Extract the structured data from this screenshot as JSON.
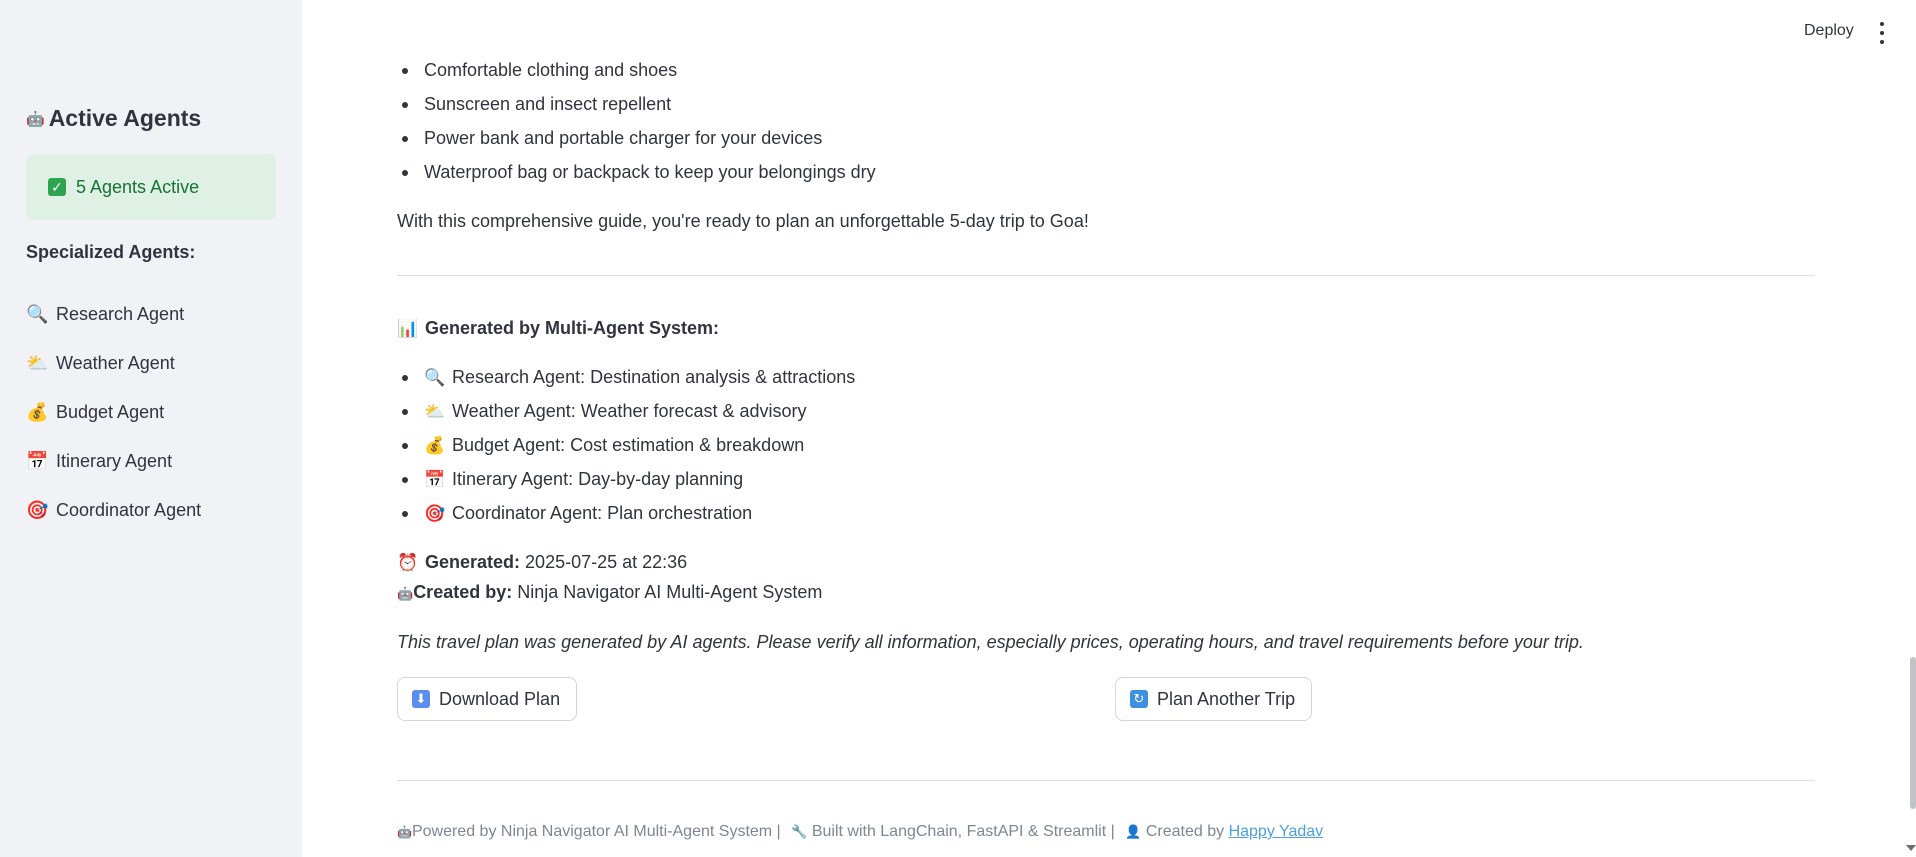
{
  "sidebar": {
    "title_emoji": "🤖",
    "title": "Active Agents",
    "status": {
      "text": "5 Agents Active",
      "color": "#177233"
    },
    "subtitle": "Specialized Agents:",
    "agents": [
      {
        "emoji": "🔍",
        "label": "Research Agent"
      },
      {
        "emoji": "⛅",
        "label": "Weather Agent"
      },
      {
        "emoji": "💰",
        "label": "Budget Agent"
      },
      {
        "emoji": "📅",
        "label": "Itinerary Agent"
      },
      {
        "emoji": "🎯",
        "label": "Coordinator Agent"
      }
    ]
  },
  "header": {
    "deploy_label": "Deploy"
  },
  "main": {
    "packing_items": [
      "Comfortable clothing and shoes",
      "Sunscreen and insect repellent",
      "Power bank and portable charger for your devices",
      "Waterproof bag or backpack to keep your belongings dry"
    ],
    "closing_text": "With this comprehensive guide, you're ready to plan an unforgettable 5-day trip to Goa!",
    "generated_heading_emoji": "📊",
    "generated_heading": "Generated by Multi-Agent System:",
    "agent_summary": [
      {
        "emoji": "🔍",
        "text": "Research Agent: Destination analysis & attractions"
      },
      {
        "emoji": "⛅",
        "text": "Weather Agent: Weather forecast & advisory"
      },
      {
        "emoji": "💰",
        "text": "Budget Agent: Cost estimation & breakdown"
      },
      {
        "emoji": "📅",
        "text": "Itinerary Agent: Day-by-day planning"
      },
      {
        "emoji": "🎯",
        "text": "Coordinator Agent: Plan orchestration"
      }
    ],
    "generated_label": "Generated:",
    "generated_value": "2025-07-25 at 22:36",
    "created_label": "Created by:",
    "created_value": "Ninja Navigator AI Multi-Agent System",
    "disclaimer": "This travel plan was generated by AI agents. Please verify all information, especially prices, operating hours, and travel requirements before your trip.",
    "download_button": "Download Plan",
    "plan_another_button": "Plan Another Trip"
  },
  "footer": {
    "powered": "Powered by Ninja Navigator AI Multi-Agent System |",
    "built": "Built with LangChain, FastAPI & Streamlit |",
    "created_prefix": "Created by",
    "author": "Happy Yadav"
  }
}
